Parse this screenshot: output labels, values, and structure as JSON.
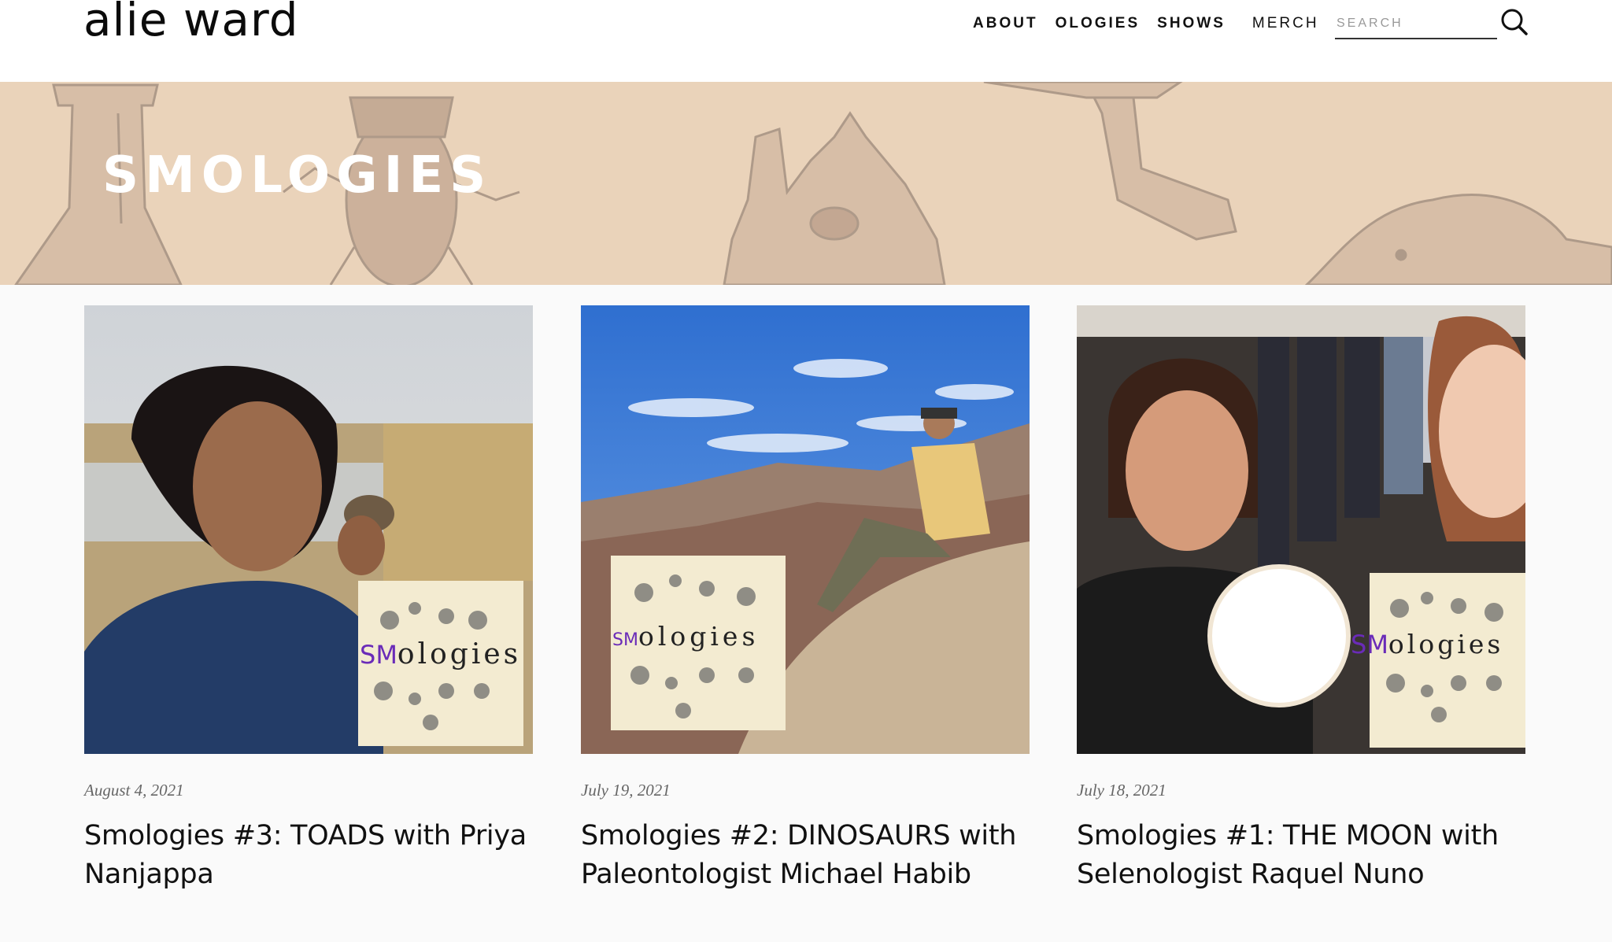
{
  "header": {
    "logo": "alie ward",
    "nav": [
      {
        "label": "ABOUT"
      },
      {
        "label": "OLOGIES"
      },
      {
        "label": "SHOWS"
      },
      {
        "label": "MERCH"
      }
    ],
    "search_placeholder": "SEARCH"
  },
  "banner": {
    "title": "SMOLOGIES",
    "background_color": "#ead3ba"
  },
  "posts": [
    {
      "date": "August 4, 2021",
      "title": "Smologies #3: TOADS with Priya Nanjappa",
      "thumbnail_badge": "Smologies"
    },
    {
      "date": "July 19, 2021",
      "title": "Smologies #2: DINOSAURS with Paleontologist Michael Habib",
      "thumbnail_badge": "smologies"
    },
    {
      "date": "July 18, 2021",
      "title": "Smologies #1: THE MOON with Selenologist Raquel Nuno",
      "thumbnail_badge": "Smologies"
    }
  ],
  "colors": {
    "accent_purple": "#6a2bb8",
    "cover_background": "#f3ebd1",
    "text_dark": "#111111",
    "date_grey": "#666666"
  }
}
